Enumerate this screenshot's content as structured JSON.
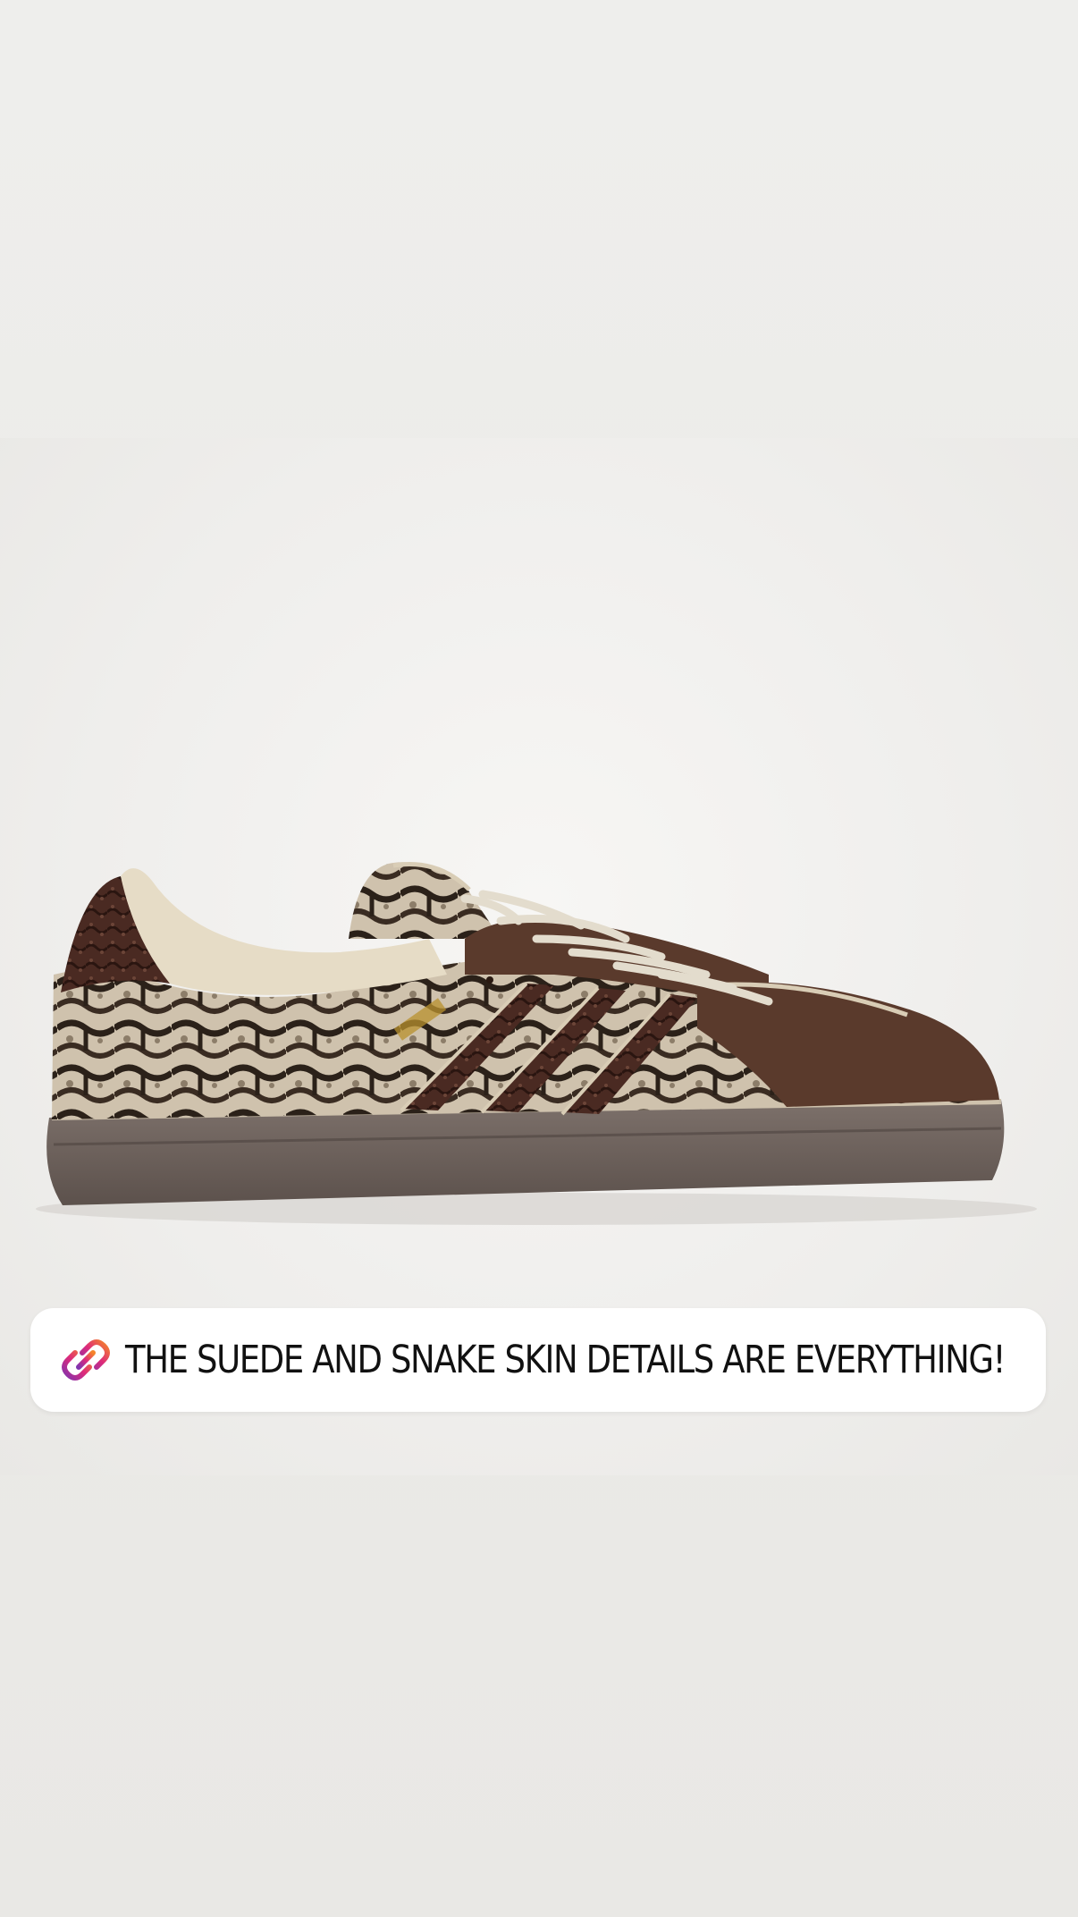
{
  "story": {
    "background_color": "#ebeae7",
    "photo": {
      "subject_icon": "sneaker-photo",
      "colors": {
        "suede": "#5a3a2c",
        "snakeskin_base": "#cfc2ad",
        "snakeskin_scales": "#2b2119",
        "sole": "#6e625c",
        "laces": "#e3dccd"
      }
    },
    "link_sticker": {
      "icon": "link-icon",
      "text": "THE SUEDE AND SNAKE SKIN DETAILS ARE EVERYTHING!",
      "icon_gradient": [
        "#f58529",
        "#dd2a7b",
        "#8134af"
      ]
    }
  }
}
